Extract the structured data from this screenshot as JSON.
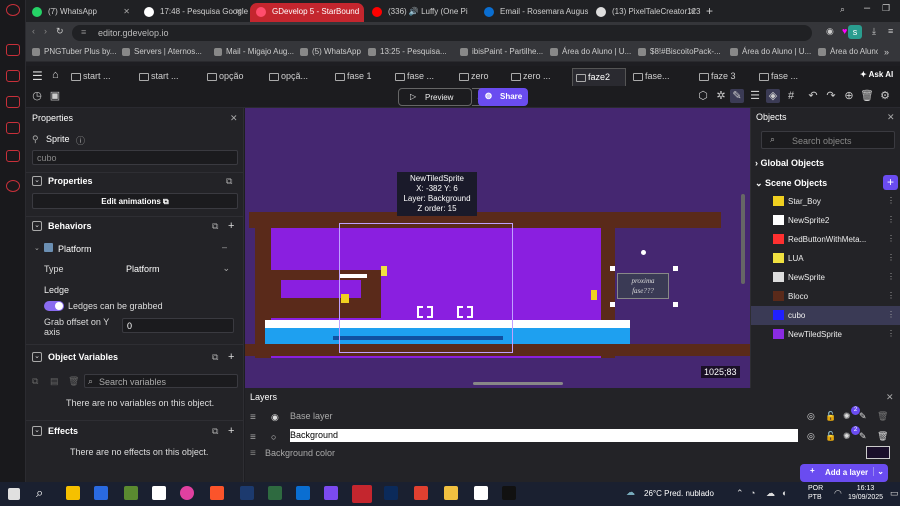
{
  "browser": {
    "tabs": [
      {
        "label": "(7) WhatsApp",
        "color": "#25d366"
      },
      {
        "label": "17:48 - Pesquisa Google",
        "color": "#ffffff"
      },
      {
        "label": "GDevelop 5 - StarBound",
        "color": "#ff4d6d"
      },
      {
        "label": "(336) 🔊 Luffy (One Pi",
        "color": "#ff0000"
      },
      {
        "label": "Email - Rosemara August",
        "color": "#0a6ed1"
      },
      {
        "label": "(13) PixelTaleCreator123",
        "color": "#dddddd"
      }
    ],
    "url": "editor.gdevelop.io",
    "bookmarks": [
      "PNGTuber Plus by...",
      "Servers | Aternos...",
      "Mail - Migajo Aug...",
      "(5) WhatsApp",
      "13:25 - Pesquisa...",
      "ibisPaint - Partilhe...",
      "Área do Aluno | U...",
      "$8!#BiscoitoPack-...",
      "Área do Aluno | U...",
      "Área do Aluno | U..."
    ]
  },
  "editor_tabs": [
    "start ...",
    "start ...",
    "opção",
    "opçã...",
    "fase 1",
    "fase ...",
    "zero",
    "zero ...",
    "faze2",
    "fase...",
    "faze 3",
    "fase ..."
  ],
  "ask_ai": "Ask AI",
  "toolbar": {
    "preview": "Preview",
    "share": "Share"
  },
  "properties": {
    "title": "Properties",
    "sprite_label": "Sprite",
    "object_name": "cubo",
    "properties_header": "Properties",
    "edit_animations": "Edit animations",
    "behaviors_header": "Behaviors",
    "platform_behavior": "Platform",
    "type_label": "Type",
    "type_value": "Platform",
    "ledge_label": "Ledge",
    "ledges_grab": "Ledges can be grabbed",
    "grab_offset_label": "Grab offset on Y axis",
    "grab_offset_value": "0",
    "object_variables_header": "Object Variables",
    "search_variables": "Search variables",
    "no_variables": "There are no variables on this object.",
    "effects_header": "Effects",
    "no_effects": "There are no effects on this object."
  },
  "canvas": {
    "tooltip": [
      "NewTiledSprite",
      "X: -382  Y: 6",
      "Layer: Background",
      "Z order: 15"
    ],
    "sign_text": [
      "proxima",
      "fase???"
    ],
    "coords": "1025;83"
  },
  "objects": {
    "title": "Objects",
    "search_placeholder": "Search objects",
    "global_objects": "Global Objects",
    "scene_objects": "Scene Objects",
    "items": [
      {
        "name": "Star_Boy",
        "thumb": "#f0d020"
      },
      {
        "name": "NewSprite2",
        "thumb": "#ffffff"
      },
      {
        "name": "RedButtonWithMeta...",
        "thumb": "#ff3030"
      },
      {
        "name": "LUA",
        "thumb": "#f0e040"
      },
      {
        "name": "NewSprite",
        "thumb": "#dddddd"
      },
      {
        "name": "Bloco",
        "thumb": "#5a2a1a"
      },
      {
        "name": "cubo",
        "thumb": "#2020ff"
      },
      {
        "name": "NewTiledSprite",
        "thumb": "#8a2be2"
      }
    ]
  },
  "layers": {
    "title": "Layers",
    "base_layer": "Base layer",
    "background_layer": "Background",
    "background_color": "Background color",
    "effect_count_1": "2",
    "effect_count_2": "2",
    "add_layer": "Add a layer"
  },
  "taskbar": {
    "weather_temp": "26°C",
    "weather_desc": "Pred. nublado",
    "lang1": "POR",
    "lang2": "PTB",
    "time": "16:13",
    "date": "19/09/2025"
  }
}
